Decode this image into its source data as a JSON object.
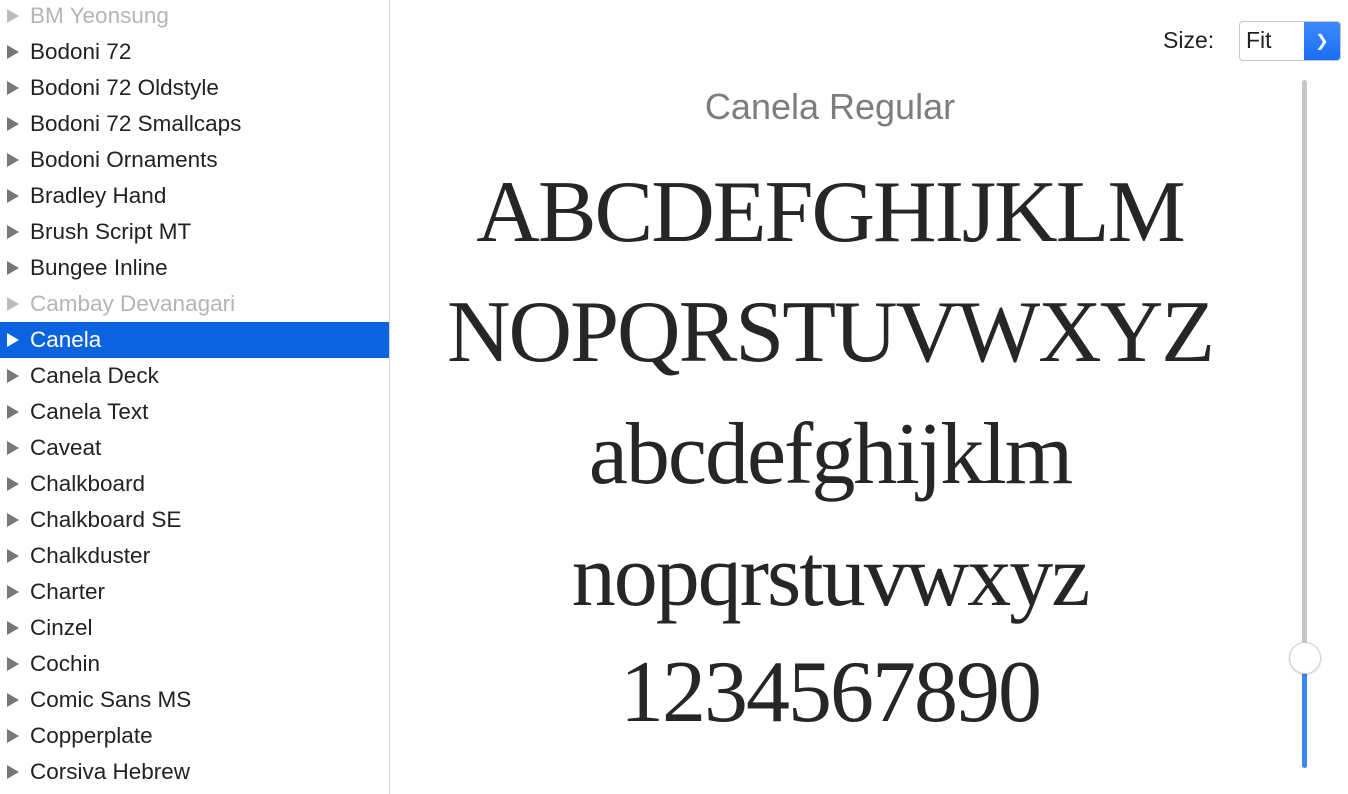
{
  "sidebar": {
    "items": [
      {
        "label": "BM Yeonsung",
        "state": "disabled"
      },
      {
        "label": "Bodoni 72",
        "state": "normal"
      },
      {
        "label": "Bodoni 72 Oldstyle",
        "state": "normal"
      },
      {
        "label": "Bodoni 72 Smallcaps",
        "state": "normal"
      },
      {
        "label": "Bodoni Ornaments",
        "state": "normal"
      },
      {
        "label": "Bradley Hand",
        "state": "normal"
      },
      {
        "label": "Brush Script MT",
        "state": "normal"
      },
      {
        "label": "Bungee Inline",
        "state": "normal"
      },
      {
        "label": "Cambay Devanagari",
        "state": "disabled"
      },
      {
        "label": "Canela",
        "state": "selected"
      },
      {
        "label": "Canela Deck",
        "state": "normal"
      },
      {
        "label": "Canela Text",
        "state": "normal"
      },
      {
        "label": "Caveat",
        "state": "normal"
      },
      {
        "label": "Chalkboard",
        "state": "normal"
      },
      {
        "label": "Chalkboard SE",
        "state": "normal"
      },
      {
        "label": "Chalkduster",
        "state": "normal"
      },
      {
        "label": "Charter",
        "state": "normal"
      },
      {
        "label": "Cinzel",
        "state": "normal"
      },
      {
        "label": "Cochin",
        "state": "normal"
      },
      {
        "label": "Comic Sans MS",
        "state": "normal"
      },
      {
        "label": "Copperplate",
        "state": "normal"
      },
      {
        "label": "Corsiva Hebrew",
        "state": "normal"
      }
    ]
  },
  "toolbar": {
    "size_label": "Size:",
    "size_value": "Fit"
  },
  "preview": {
    "title": "Canela Regular",
    "lines": [
      "ABCDEFGHIJKLM",
      "NOPQRSTUVWXYZ",
      "abcdefghijklm",
      "nopqrstuvwxyz",
      "1234567890"
    ],
    "size_slider_fraction": 0.16
  },
  "colors": {
    "accent": "#0b63e0",
    "slider_fill": "#3a86f7"
  }
}
